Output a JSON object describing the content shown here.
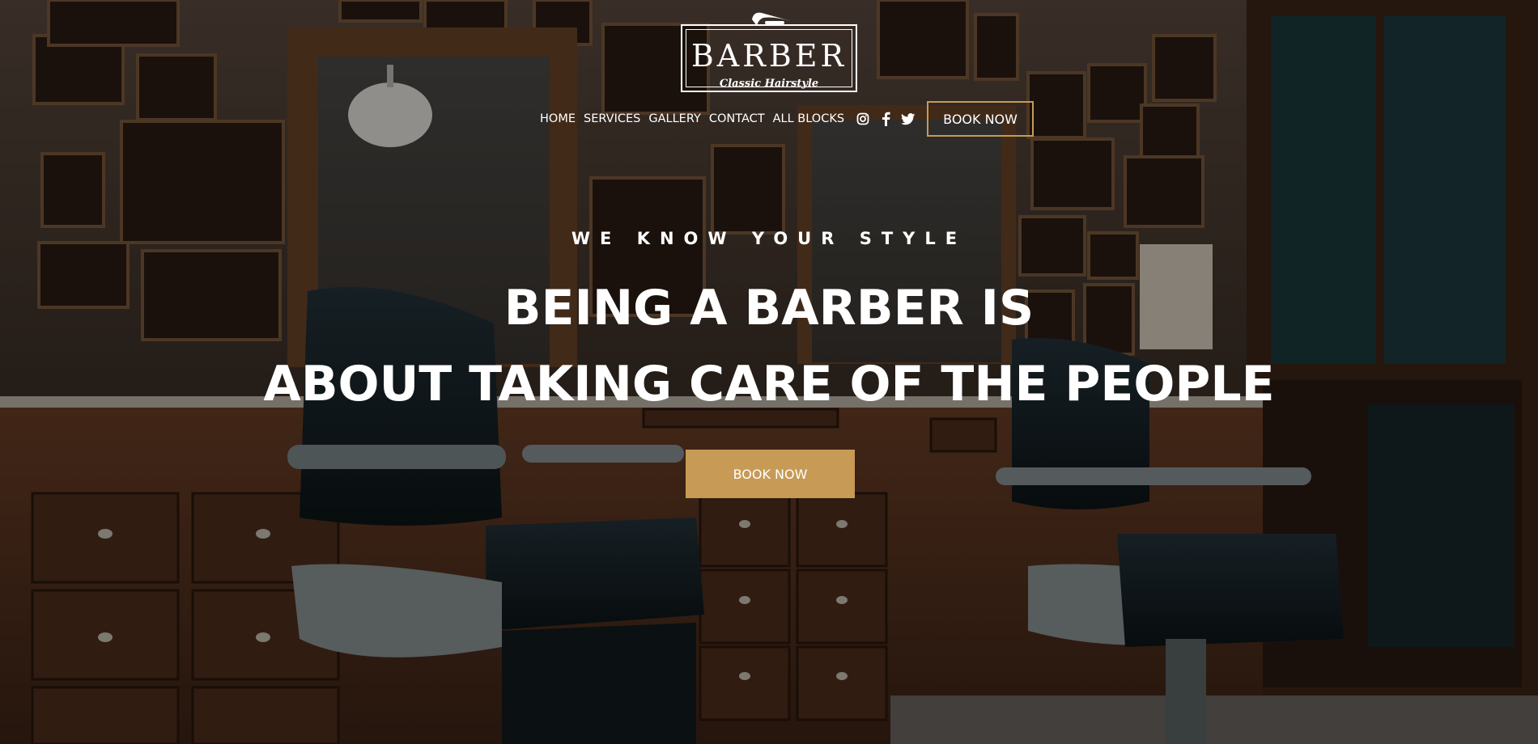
{
  "logo": {
    "word": "BARBER",
    "subtitle": "Classic Hairstyle"
  },
  "nav": {
    "links": [
      "HOME",
      "SERVICES",
      "GALLERY",
      "CONTACT",
      "ALL BLOCKS"
    ],
    "social_icons": [
      "instagram-icon",
      "facebook-icon",
      "twitter-icon"
    ],
    "book_label": "BOOK NOW"
  },
  "hero": {
    "tagline": "WE KNOW YOUR STYLE",
    "headline_line1": "BEING A BARBER IS",
    "headline_line2": "ABOUT TAKING CARE OF THE PEOPLE",
    "cta_label": "BOOK NOW"
  },
  "colors": {
    "accent": "#c79a55",
    "text": "#ffffff",
    "overlay": "rgba(0,0,0,0.38)"
  }
}
